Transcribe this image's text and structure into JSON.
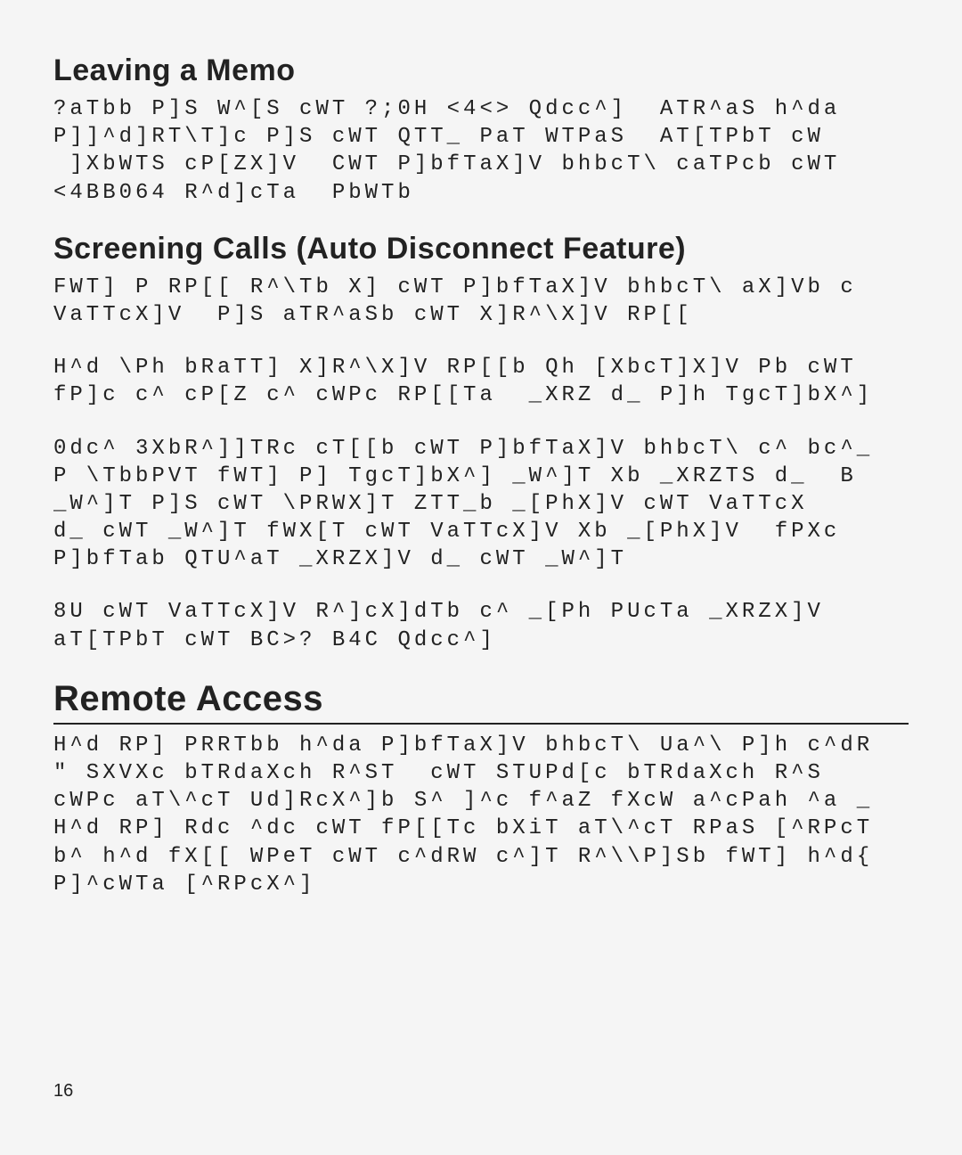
{
  "sections": {
    "s1": {
      "title": "Leaving a Memo",
      "body": "?aTbb P]S W^[S cWT ?;0H <4<> Qdcc^]  ATR^aS h^da\nP]]^d]RT\\T]c P]S cWT QTT_ PaT WTPaS  AT[TPbT cW\n ]XbWTS cP[ZX]V  CWT P]bfTaX]V bhbcT\\ caTPcb cWT\n<4BB064 R^d]cTa  PbWTb "
    },
    "s2": {
      "title": "Screening Calls (Auto Disconnect Feature)",
      "body1": "FWT] P RP[[ R^\\Tb X] cWT P]bfTaX]V bhbcT\\ aX]Vb c\nVaTTcX]V  P]S aTR^aSb cWT X]R^\\X]V RP[[ ",
      "body2": "H^d \\Ph bRaTT] X]R^\\X]V RP[[b Qh [XbcT]X]V Pb cWT\nfP]c c^ cP[Z c^ cWPc RP[[Ta  _XRZ d_ P]h TgcT]bX^]",
      "body3": "0dc^ 3XbR^]]TRc cT[[b cWT P]bfTaX]V bhbcT\\ c^ bc^_\nP \\TbbPVT fWT] P] TgcT]bX^] _W^]T Xb _XRZTS d_  B\n_W^]T P]S cWT \\PRWX]T ZTT_b _[PhX]V cWT VaTTcX\nd_ cWT _W^]T fWX[T cWT VaTTcX]V Xb _[PhX]V  fPXc\nP]bfTab QTU^aT _XRZX]V d_ cWT _W^]T ",
      "body4": "8U cWT VaTTcX]V R^]cX]dTb c^ _[Ph PUcTa _XRZX]V\naT[TPbT cWT BC>? B4C Qdcc^] "
    },
    "s3": {
      "title": "Remote Access",
      "body": "H^d RP] PRRTbb h^da P]bfTaX]V bhbcT\\ Ua^\\ P]h c^dR\n\" SXVXc bTRdaXch R^ST  cWT STUPd[c bTRdaXch R^S\ncWPc aT\\^cT Ud]RcX^]b S^ ]^c f^aZ fXcW a^cPah ^a _\nH^d RP] Rdc ^dc cWT fP[[Tc bXiT aT\\^cT RPaS [^RPcT\nb^ h^d fX[[ WPeT cWT c^dRW c^]T R^\\\\P]Sb fWT] h^d{\nP]^cWTa [^RPcX^]"
    }
  },
  "page_number": "16"
}
